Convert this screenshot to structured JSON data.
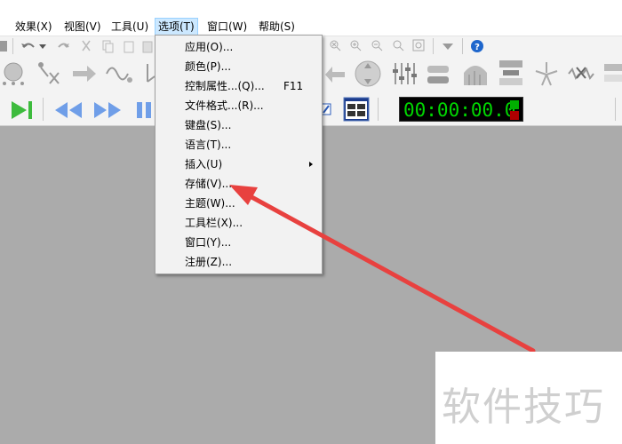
{
  "menubar": {
    "items": [
      {
        "label": "效果(X)"
      },
      {
        "label": "视图(V)"
      },
      {
        "label": "工具(U)"
      },
      {
        "label": "选项(T)"
      },
      {
        "label": "窗口(W)"
      },
      {
        "label": "帮助(S)"
      }
    ]
  },
  "options_menu": {
    "items": [
      {
        "label": "应用(O)...",
        "shortcut": ""
      },
      {
        "label": "颜色(P)...",
        "shortcut": ""
      },
      {
        "label": "控制属性...(Q)...",
        "shortcut": "F11"
      },
      {
        "label": "文件格式...(R)...",
        "shortcut": ""
      },
      {
        "label": "键盘(S)...",
        "shortcut": ""
      },
      {
        "label": "语言(T)...",
        "shortcut": ""
      },
      {
        "label": "插入(U)",
        "shortcut": ""
      },
      {
        "label": "存储(V)...",
        "shortcut": ""
      },
      {
        "label": "主题(W)...",
        "shortcut": ""
      },
      {
        "label": "工具栏(X)...",
        "shortcut": ""
      },
      {
        "label": "窗口(Y)...",
        "shortcut": ""
      },
      {
        "label": "注册(Z)...",
        "shortcut": ""
      }
    ]
  },
  "transport": {
    "timecode": "00:00:00.0"
  },
  "watermark": {
    "text": "软件技巧"
  },
  "colors": {
    "menu_highlight": "#cce8ff",
    "arrow": "#e8413f",
    "timecode_bg": "#000000",
    "timecode_fg": "#00d800",
    "workspace": "#ababab",
    "play_green": "#3dbb3d",
    "transport_blue": "#6f9ee8"
  },
  "icons": [
    "help-icon",
    "play-icon",
    "rewind-icon",
    "fast-forward-icon",
    "pause-icon",
    "zoom-in-icon",
    "zoom-out-icon",
    "undo-icon",
    "redo-icon"
  ]
}
